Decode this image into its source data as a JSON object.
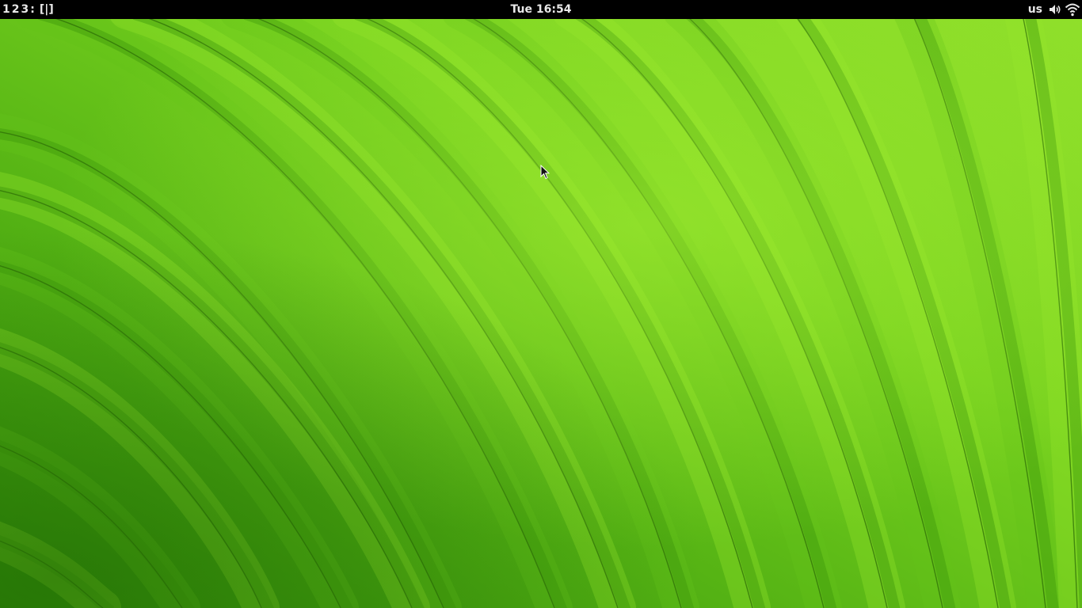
{
  "topbar": {
    "workspaces": [
      "1",
      "2",
      "3"
    ],
    "separator": ":",
    "layout_indicator": "[|]",
    "clock": "Tue 16:54",
    "keyboard_layout": "us",
    "icons": {
      "volume": "volume-icon",
      "wifi": "wifi-icon"
    }
  },
  "desktop": {
    "wallpaper": "green-leaf-closeup",
    "colors": {
      "bar": "#000000",
      "bar_text": "#e8e8e8",
      "leaf_dark": "#3f9a0c",
      "leaf_mid": "#63c21a",
      "leaf_light": "#95e52a"
    }
  }
}
